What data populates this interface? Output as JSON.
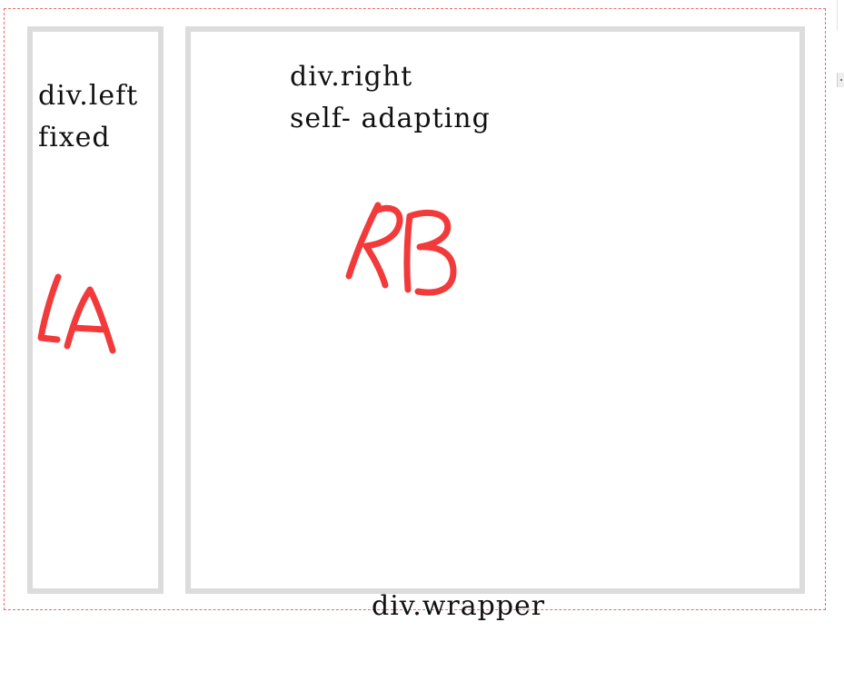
{
  "wrapper": {
    "label": "div.wrapper"
  },
  "left_box": {
    "label": "div.left\nfixed",
    "handwritten": "LA"
  },
  "right_box": {
    "label": "div.right\nself- adapting",
    "handwritten": "RB"
  },
  "colors": {
    "wrapper_border": "#e86a6a",
    "box_border": "#dcdcdc",
    "handwriting": "#f23a3a"
  }
}
